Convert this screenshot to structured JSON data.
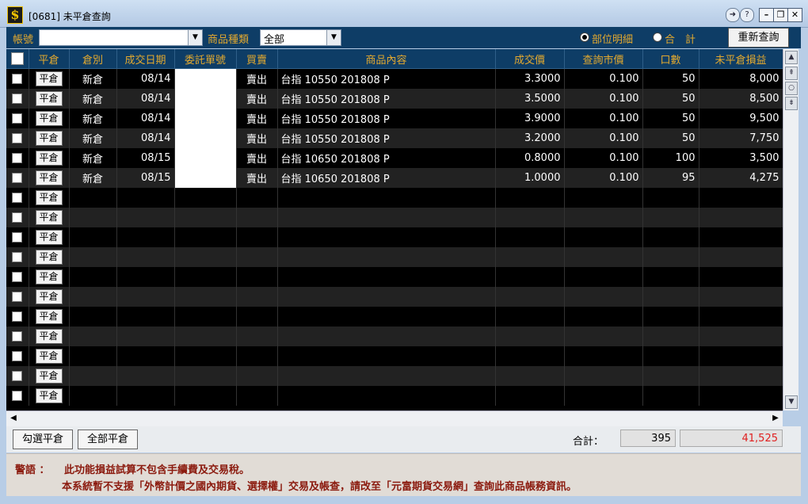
{
  "window": {
    "title": "[0681] 未平倉查詢",
    "app_icon": "$"
  },
  "toolbar": {
    "account_label": "帳號",
    "account_value": "",
    "product_type_label": "商品種類",
    "product_type_value": "全部",
    "radio_detail_label": "部位明細",
    "radio_total_label": "合　計",
    "refresh_label": "重新查詢"
  },
  "table": {
    "headers": [
      "平倉",
      "倉別",
      "成交日期",
      "委託單號",
      "買賣",
      "商品內容",
      "成交價",
      "查詢市價",
      "口數",
      "未平倉損益"
    ],
    "close_label": "平倉",
    "rows": [
      {
        "type": "新倉",
        "date": "08/14",
        "order": "",
        "side": "賣出",
        "product": "台指 10550 201808 P",
        "price": "3.3000",
        "market": "0.100",
        "qty": "50",
        "pnl": "8,000"
      },
      {
        "type": "新倉",
        "date": "08/14",
        "order": "",
        "side": "賣出",
        "product": "台指 10550 201808 P",
        "price": "3.5000",
        "market": "0.100",
        "qty": "50",
        "pnl": "8,500"
      },
      {
        "type": "新倉",
        "date": "08/14",
        "order": "",
        "side": "賣出",
        "product": "台指 10550 201808 P",
        "price": "3.9000",
        "market": "0.100",
        "qty": "50",
        "pnl": "9,500"
      },
      {
        "type": "新倉",
        "date": "08/14",
        "order": "",
        "side": "賣出",
        "product": "台指 10550 201808 P",
        "price": "3.2000",
        "market": "0.100",
        "qty": "50",
        "pnl": "7,750"
      },
      {
        "type": "新倉",
        "date": "08/15",
        "order": "",
        "side": "賣出",
        "product": "台指 10650 201808 P",
        "price": "0.8000",
        "market": "0.100",
        "qty": "100",
        "pnl": "3,500"
      },
      {
        "type": "新倉",
        "date": "08/15",
        "order": "",
        "side": "賣出",
        "product": "台指 10650 201808 P",
        "price": "1.0000",
        "market": "0.100",
        "qty": "95",
        "pnl": "4,275"
      }
    ],
    "empty_rows": 11
  },
  "bottom": {
    "select_close_label": "勾選平倉",
    "close_all_label": "全部平倉",
    "total_label": "合計：",
    "total_qty": "395",
    "total_pnl": "41,525"
  },
  "warning": {
    "prefix": "警語 ：",
    "line1": "此功能損益試算不包含手續費及交易稅。",
    "line2": "本系統暫不支援「外幣計價之國內期貨、選擇權」交易及帳查，請改至「元富期貨交易網」查詢此商品帳務資訊。"
  },
  "colors": {
    "header_bg": "#0e3d66",
    "header_text": "#e3a92f",
    "sell_text": "#27c12d",
    "pnl_text": "#e02020",
    "warning_text": "#8b1a0e"
  }
}
